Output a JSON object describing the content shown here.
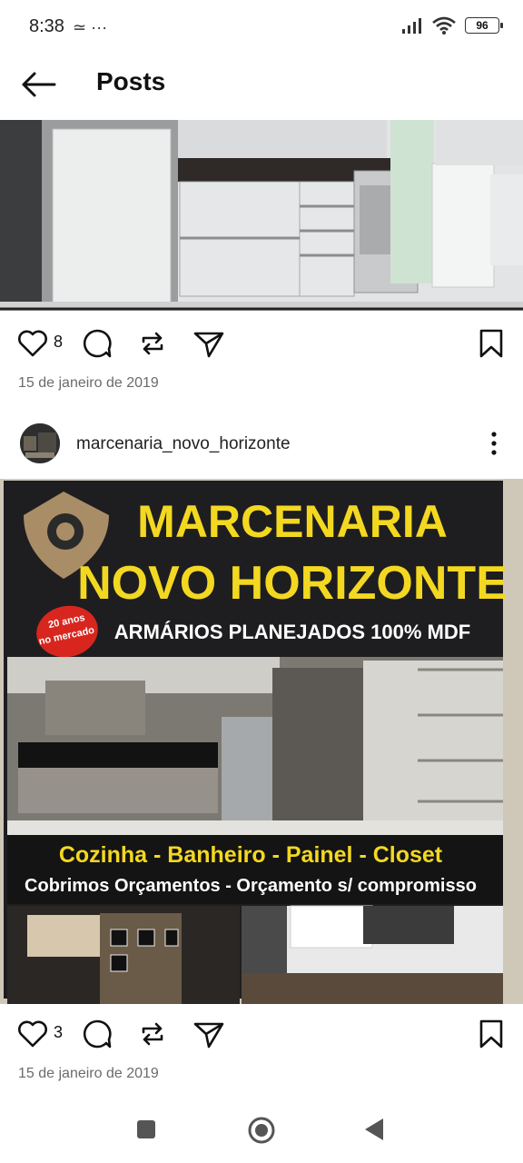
{
  "status_bar": {
    "time": "8:38",
    "left_icons": "≃ ···",
    "battery": "96"
  },
  "header": {
    "title": "Posts",
    "back_icon": "arrow-left-icon"
  },
  "post1": {
    "likes": "8",
    "date": "15 de janeiro de 2019"
  },
  "post2": {
    "username": "marcenaria_novo_horizonte",
    "likes": "3",
    "date": "15 de janeiro de 2019",
    "flyer": {
      "title_line1": "MARCENARIA",
      "title_line2": "NOVO HORIZONTE",
      "badge_line1": "20 anos",
      "badge_line2": "no mercado",
      "subtitle": "ARMÁRIOS PLANEJADOS 100% MDF",
      "services": "Cozinha - Banheiro - Painel - Closet",
      "tagline": "Cobrimos Orçamentos -  Orçamento s/ compromisso"
    }
  },
  "colors": {
    "flyer_yellow": "#f3d821",
    "flyer_dark": "#1d1d1f",
    "badge_red": "#d8261f"
  },
  "icons": [
    "heart-icon",
    "comment-icon",
    "repost-icon",
    "send-icon",
    "bookmark-icon",
    "more-vertical-icon"
  ],
  "nav": [
    "recents-button",
    "home-button",
    "back-button"
  ]
}
